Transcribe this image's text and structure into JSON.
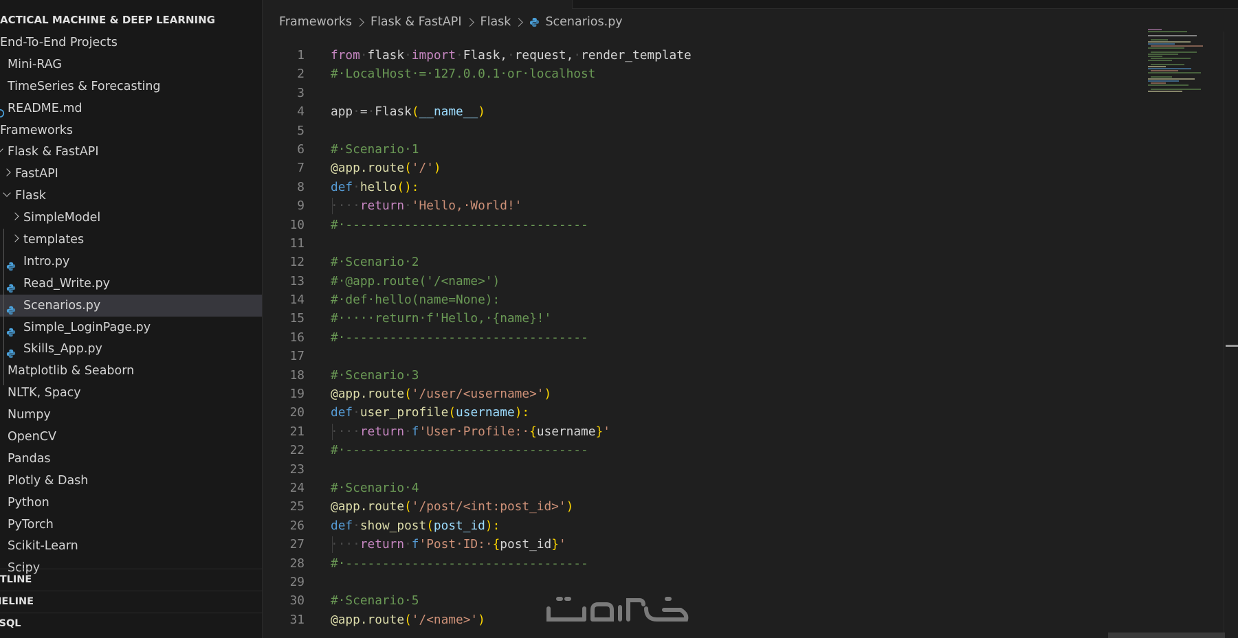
{
  "explorer": {
    "root_title": "ACTICAL MACHINE & DEEP LEARNING",
    "items": [
      {
        "label": "End-To-End  Projects",
        "depth": 0,
        "kind": "folder"
      },
      {
        "label": "Mini-RAG",
        "depth": 1,
        "kind": "folder"
      },
      {
        "label": "TimeSeries & Forecasting",
        "depth": 1,
        "kind": "folder"
      },
      {
        "label": "README.md",
        "depth": 1,
        "kind": "md"
      },
      {
        "label": "Frameworks",
        "depth": 0,
        "kind": "folder"
      },
      {
        "label": "Flask & FastAPI",
        "depth": 1,
        "kind": "folder-open"
      },
      {
        "label": "FastAPI",
        "depth": 2,
        "kind": "folder-closed"
      },
      {
        "label": "Flask",
        "depth": 2,
        "kind": "folder-open"
      },
      {
        "label": "SimpleModel",
        "depth": 3,
        "kind": "folder-closed"
      },
      {
        "label": "templates",
        "depth": 3,
        "kind": "folder-closed"
      },
      {
        "label": "Intro.py",
        "depth": 3,
        "kind": "py"
      },
      {
        "label": "Read_Write.py",
        "depth": 3,
        "kind": "py"
      },
      {
        "label": "Scenarios.py",
        "depth": 3,
        "kind": "py",
        "selected": true
      },
      {
        "label": "Simple_LoginPage.py",
        "depth": 3,
        "kind": "py"
      },
      {
        "label": "Skills_App.py",
        "depth": 3,
        "kind": "py"
      },
      {
        "label": "Matplotlib & Seaborn",
        "depth": 1,
        "kind": "folder"
      },
      {
        "label": "NLTK, Spacy",
        "depth": 1,
        "kind": "folder"
      },
      {
        "label": "Numpy",
        "depth": 1,
        "kind": "folder"
      },
      {
        "label": "OpenCV",
        "depth": 1,
        "kind": "folder"
      },
      {
        "label": "Pandas",
        "depth": 1,
        "kind": "folder"
      },
      {
        "label": "Plotly & Dash",
        "depth": 1,
        "kind": "folder"
      },
      {
        "label": "Python",
        "depth": 1,
        "kind": "folder"
      },
      {
        "label": "PyTorch",
        "depth": 1,
        "kind": "folder"
      },
      {
        "label": "Scikit-Learn",
        "depth": 1,
        "kind": "folder"
      },
      {
        "label": "Scipy",
        "depth": 1,
        "kind": "folder"
      }
    ]
  },
  "panels": {
    "outline": "UTLINE",
    "timeline": "MELINE",
    "mysql": "YSQL"
  },
  "breadcrumb": [
    "Frameworks",
    "Flask & FastAPI",
    "Flask",
    "Scenarios.py"
  ],
  "colors": {
    "python_icon": "#4a9fd8",
    "selected_row": "#37373d",
    "background": "#1f1f1f"
  },
  "code": [
    [
      [
        "kw-pink",
        "from"
      ],
      [
        "ws",
        "·"
      ],
      [
        "plain",
        "flask"
      ],
      [
        "ws",
        "·"
      ],
      [
        "kw-pink",
        "import"
      ],
      [
        "ws",
        "·"
      ],
      [
        "plain",
        "Flask,"
      ],
      [
        "ws",
        "·"
      ],
      [
        "plain",
        "request,"
      ],
      [
        "ws",
        "·"
      ],
      [
        "plain",
        "render_template"
      ]
    ],
    [
      [
        "cmt",
        "#·LocalHost·=·127.0.0.1·or·localhost"
      ]
    ],
    [],
    [
      [
        "plain",
        "app"
      ],
      [
        "ws",
        "·"
      ],
      [
        "plain",
        "="
      ],
      [
        "ws",
        "·"
      ],
      [
        "plain",
        "Flask"
      ],
      [
        "br",
        "("
      ],
      [
        "var",
        "__name__"
      ],
      [
        "br",
        ")"
      ]
    ],
    [],
    [
      [
        "cmt",
        "#·Scenario·1"
      ]
    ],
    [
      [
        "fn",
        "@app.route"
      ],
      [
        "br",
        "("
      ],
      [
        "str",
        "'/'"
      ],
      [
        "br",
        ")"
      ]
    ],
    [
      [
        "kw-blue",
        "def"
      ],
      [
        "ws",
        "·"
      ],
      [
        "fn",
        "hello"
      ],
      [
        "br",
        "():"
      ]
    ],
    [
      [
        "ws",
        "····"
      ],
      [
        "kw-pink",
        "return"
      ],
      [
        "ws",
        "·"
      ],
      [
        "str",
        "'Hello,·World!'"
      ]
    ],
    [
      [
        "cmt",
        "#·---------------------------------"
      ]
    ],
    [],
    [
      [
        "cmt",
        "#·Scenario·2"
      ]
    ],
    [
      [
        "cmt",
        "#·@app.route('/<name>')"
      ]
    ],
    [
      [
        "cmt",
        "#·def·hello(name=None):"
      ]
    ],
    [
      [
        "cmt",
        "#·····return·f'Hello,·{name}!'"
      ]
    ],
    [
      [
        "cmt",
        "#·---------------------------------"
      ]
    ],
    [],
    [
      [
        "cmt",
        "#·Scenario·3"
      ]
    ],
    [
      [
        "fn",
        "@app.route"
      ],
      [
        "br",
        "("
      ],
      [
        "str",
        "'/user/<username>'"
      ],
      [
        "br",
        ")"
      ]
    ],
    [
      [
        "kw-blue",
        "def"
      ],
      [
        "ws",
        "·"
      ],
      [
        "fn",
        "user_profile"
      ],
      [
        "br",
        "("
      ],
      [
        "var",
        "username"
      ],
      [
        "br",
        "):"
      ]
    ],
    [
      [
        "ws",
        "····"
      ],
      [
        "kw-pink",
        "return"
      ],
      [
        "ws",
        "·"
      ],
      [
        "kw-blue",
        "f"
      ],
      [
        "str",
        "'User·Profile:·"
      ],
      [
        "br",
        "{"
      ],
      [
        "plain",
        "username"
      ],
      [
        "br",
        "}"
      ],
      [
        "str",
        "'"
      ]
    ],
    [
      [
        "cmt",
        "#·---------------------------------"
      ]
    ],
    [],
    [
      [
        "cmt",
        "#·Scenario·4"
      ]
    ],
    [
      [
        "fn",
        "@app.route"
      ],
      [
        "br",
        "("
      ],
      [
        "str",
        "'/post/<int:post_id>'"
      ],
      [
        "br",
        ")"
      ]
    ],
    [
      [
        "kw-blue",
        "def"
      ],
      [
        "ws",
        "·"
      ],
      [
        "fn",
        "show_post"
      ],
      [
        "br",
        "("
      ],
      [
        "var",
        "post_id"
      ],
      [
        "br",
        "):"
      ]
    ],
    [
      [
        "ws",
        "····"
      ],
      [
        "kw-pink",
        "return"
      ],
      [
        "ws",
        "·"
      ],
      [
        "kw-blue",
        "f"
      ],
      [
        "str",
        "'Post·ID:·"
      ],
      [
        "br",
        "{"
      ],
      [
        "plain",
        "post_id"
      ],
      [
        "br",
        "}"
      ],
      [
        "str",
        "'"
      ]
    ],
    [
      [
        "cmt",
        "#·---------------------------------"
      ]
    ],
    [],
    [
      [
        "cmt",
        "#·Scenario·5"
      ]
    ],
    [
      [
        "fn",
        "@app.route"
      ],
      [
        "br",
        "("
      ],
      [
        "str",
        "'/<name>'"
      ],
      [
        "br",
        ")"
      ]
    ]
  ]
}
